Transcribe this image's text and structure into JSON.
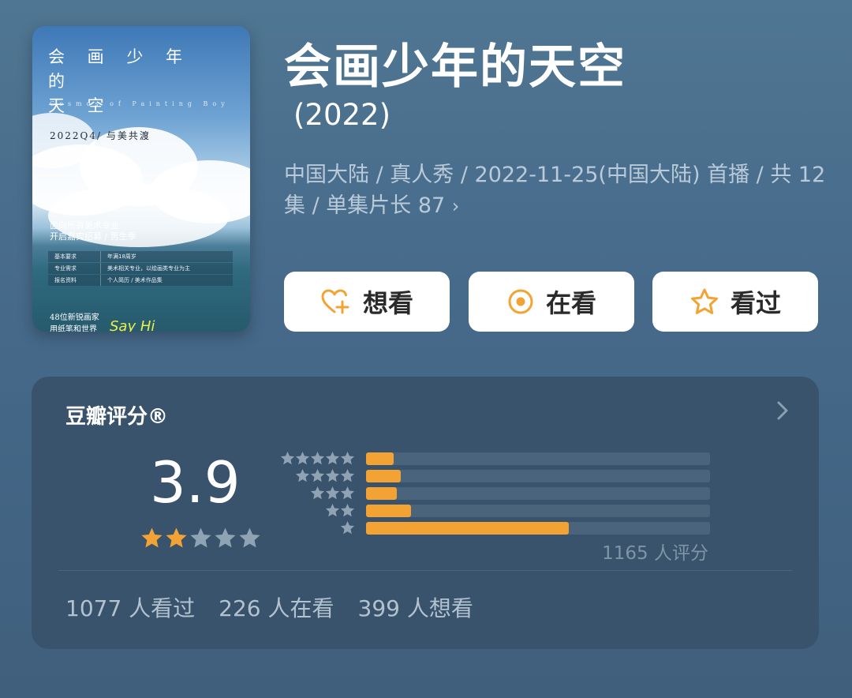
{
  "poster": {
    "title_line1": "会 画 少 年 的",
    "title_line2": "天 空",
    "subtitle_en": "Cosmos of Painting Boy",
    "season": "2022Q4/ 与美共渡",
    "recruit_line1": "面向所有美术专业",
    "recruit_line2": "开启嘉宾招募 / 男生季",
    "table": [
      {
        "k": "基本要求",
        "v": "年满18周岁"
      },
      {
        "k": "专业需求",
        "v": "美术相关专业，以绘画类专业为主"
      },
      {
        "k": "报名资料",
        "v": "个人简历 / 美术作品集"
      }
    ],
    "bottom_line1": "48位新锐画家",
    "bottom_line2": "用纸笔和世界",
    "sayhi": "Say Hi"
  },
  "header": {
    "title": "会画少年的天空",
    "year": "(2022)",
    "meta": "中国大陆 / 真人秀 / 2022-11-25(中国大陆) 首播 / 共 12 集 / 单集片长 87",
    "meta_chevron": "›"
  },
  "actions": {
    "want_label": "想看",
    "watching_label": "在看",
    "watched_label": "看过"
  },
  "rating": {
    "title": "豆瓣评分®",
    "score": "3.9",
    "star_count": 2,
    "distribution": [
      {
        "stars": 5,
        "fraction": 0.08
      },
      {
        "stars": 4,
        "fraction": 0.1
      },
      {
        "stars": 3,
        "fraction": 0.09
      },
      {
        "stars": 2,
        "fraction": 0.13
      },
      {
        "stars": 1,
        "fraction": 0.59
      }
    ],
    "total": "1165 人评分",
    "watched": "1077 人看过",
    "watching": "226 人在看",
    "want": "399 人想看"
  },
  "colors": {
    "accent": "#f3a333",
    "card": "#38536b",
    "bar_track": "#4a647b",
    "star_off": "#8fa3b4"
  }
}
